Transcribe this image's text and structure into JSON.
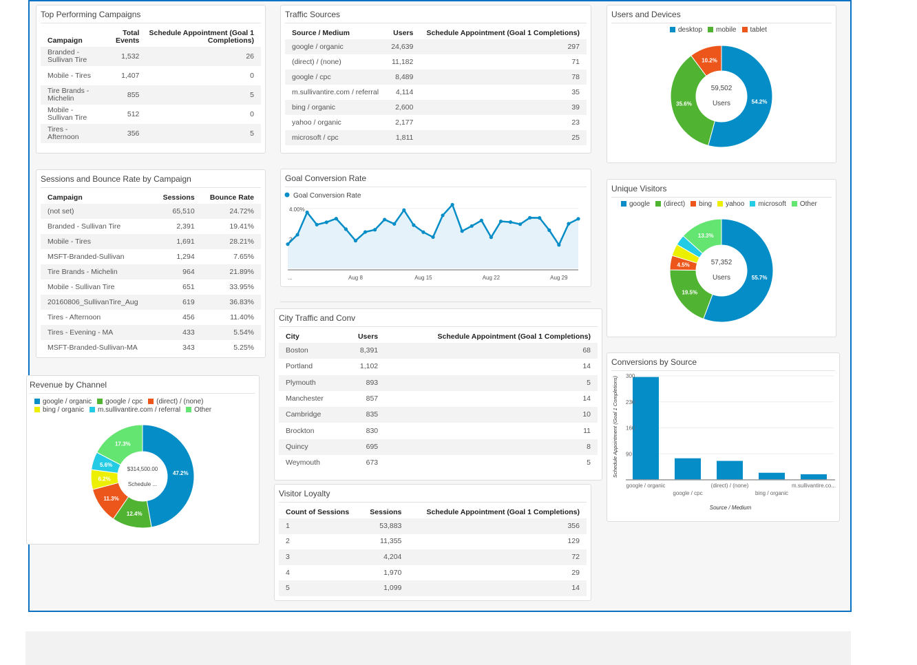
{
  "colors": {
    "frame": "#0a72c2",
    "blue": "#058dc7",
    "green": "#50b432",
    "orange": "#ed561b",
    "yellow": "#edef00",
    "cyan": "#24cbe5",
    "lightgreen": "#64e572"
  },
  "panels": {
    "top_campaigns": "Top Performing Campaigns",
    "traffic_sources": "Traffic Sources",
    "users_devices": "Users and Devices",
    "sessions_bounce": "Sessions and Bounce Rate by Campaign",
    "goal_conversion": "Goal Conversion Rate",
    "city_traffic": "City Traffic and Conv",
    "visitor_loyalty": "Visitor Loyalty",
    "unique_visitors": "Unique Visitors",
    "conversions_source": "Conversions by Source",
    "revenue_channel": "Revenue by Channel"
  },
  "top_campaigns": {
    "columns": [
      "Campaign",
      "Total Events",
      "Schedule Appointment (Goal 1 Completions)"
    ],
    "rows": [
      [
        "Branded - Sullivan Tire",
        "1,532",
        "26"
      ],
      [
        "Mobile - Tires",
        "1,407",
        "0"
      ],
      [
        "Tire Brands - Michelin",
        "855",
        "5"
      ],
      [
        "Mobile - Sullivan Tire",
        "512",
        "0"
      ],
      [
        "Tires - Afternoon",
        "356",
        "5"
      ]
    ]
  },
  "traffic_sources": {
    "columns": [
      "Source / Medium",
      "Users",
      "Schedule Appointment (Goal 1 Completions)"
    ],
    "rows": [
      [
        "google / organic",
        "24,639",
        "297"
      ],
      [
        "(direct) / (none)",
        "11,182",
        "71"
      ],
      [
        "google / cpc",
        "8,489",
        "78"
      ],
      [
        "m.sullivantire.com / referral",
        "4,114",
        "35"
      ],
      [
        "bing / organic",
        "2,600",
        "39"
      ],
      [
        "yahoo / organic",
        "2,177",
        "23"
      ],
      [
        "microsoft / cpc",
        "1,811",
        "25"
      ]
    ]
  },
  "sessions_bounce": {
    "columns": [
      "Campaign",
      "Sessions",
      "Bounce Rate"
    ],
    "rows": [
      [
        "(not set)",
        "65,510",
        "24.72%"
      ],
      [
        "Branded - Sullivan Tire",
        "2,391",
        "19.41%"
      ],
      [
        "Mobile - Tires",
        "1,691",
        "28.21%"
      ],
      [
        "MSFT-Branded-Sullivan",
        "1,294",
        "7.65%"
      ],
      [
        "Tire Brands - Michelin",
        "964",
        "21.89%"
      ],
      [
        "Mobile - Sullivan Tire",
        "651",
        "33.95%"
      ],
      [
        "20160806_SullivanTire_Aug",
        "619",
        "36.83%"
      ],
      [
        "Tires - Afternoon",
        "456",
        "11.40%"
      ],
      [
        "Tires - Evening - MA",
        "433",
        "5.54%"
      ],
      [
        "MSFT-Branded-Sullivan-MA",
        "343",
        "5.25%"
      ]
    ]
  },
  "city_traffic": {
    "columns": [
      "City",
      "Users",
      "Schedule Appointment (Goal 1 Completions)"
    ],
    "rows": [
      [
        "Boston",
        "8,391",
        "68"
      ],
      [
        "Portland",
        "1,102",
        "14"
      ],
      [
        "Plymouth",
        "893",
        "5"
      ],
      [
        "Manchester",
        "857",
        "14"
      ],
      [
        "Cambridge",
        "835",
        "10"
      ],
      [
        "Brockton",
        "830",
        "11"
      ],
      [
        "Quincy",
        "695",
        "8"
      ],
      [
        "Weymouth",
        "673",
        "5"
      ]
    ]
  },
  "visitor_loyalty": {
    "columns": [
      "Count of Sessions",
      "Sessions",
      "Schedule Appointment (Goal 1 Completions)"
    ],
    "rows": [
      [
        "1",
        "53,883",
        "356"
      ],
      [
        "2",
        "11,355",
        "129"
      ],
      [
        "3",
        "4,204",
        "72"
      ],
      [
        "4",
        "1,970",
        "29"
      ],
      [
        "5",
        "1,099",
        "14"
      ]
    ]
  },
  "chart_data": [
    {
      "type": "pie",
      "donut": true,
      "center_value": "59,502",
      "center_label": "Users",
      "legend_position": "top",
      "slices": [
        {
          "name": "desktop",
          "value": 54.2,
          "label": "54.2%",
          "color": "#058dc7"
        },
        {
          "name": "mobile",
          "value": 35.6,
          "label": "35.6%",
          "color": "#50b432"
        },
        {
          "name": "tablet",
          "value": 10.2,
          "label": "10.2%",
          "color": "#ed561b"
        }
      ]
    },
    {
      "type": "pie",
      "donut": true,
      "center_value": "57,352",
      "center_label": "Users",
      "legend_position": "top",
      "slices": [
        {
          "name": "google",
          "value": 55.7,
          "label": "55.7%",
          "color": "#058dc7"
        },
        {
          "name": "(direct)",
          "value": 19.5,
          "label": "19.5%",
          "color": "#50b432"
        },
        {
          "name": "bing",
          "value": 4.5,
          "label": "4.5%",
          "color": "#ed561b"
        },
        {
          "name": "yahoo",
          "value": 3.7,
          "label": "",
          "color": "#edef00"
        },
        {
          "name": "microsoft",
          "value": 3.3,
          "label": "",
          "color": "#24cbe5"
        },
        {
          "name": "Other",
          "value": 13.3,
          "label": "13.3%",
          "color": "#64e572"
        }
      ]
    },
    {
      "type": "pie",
      "donut": true,
      "center_value": "$314,500.00",
      "center_label": "Schedule ...",
      "legend_position": "top",
      "slices": [
        {
          "name": "google / organic",
          "value": 47.2,
          "label": "47.2%",
          "color": "#058dc7"
        },
        {
          "name": "google / cpc",
          "value": 12.4,
          "label": "12.4%",
          "color": "#50b432"
        },
        {
          "name": "(direct) / (none)",
          "value": 11.3,
          "label": "11.3%",
          "color": "#ed561b"
        },
        {
          "name": "bing / organic",
          "value": 6.2,
          "label": "6.2%",
          "color": "#edef00"
        },
        {
          "name": "m.sullivantire.com / referral",
          "value": 5.6,
          "label": "5.6%",
          "color": "#24cbe5"
        },
        {
          "name": "Other",
          "value": 17.3,
          "label": "17.3%",
          "color": "#64e572"
        }
      ]
    },
    {
      "type": "area",
      "series": [
        {
          "name": "Goal Conversion Rate",
          "color": "#058dc7",
          "values": [
            1.62,
            2.25,
            3.74,
            2.92,
            3.08,
            3.32,
            2.62,
            1.85,
            2.43,
            2.58,
            3.26,
            2.97,
            3.89,
            2.89,
            2.42,
            2.09,
            3.54,
            4.25,
            2.49,
            2.83,
            3.2,
            2.08,
            3.14,
            3.09,
            2.95,
            3.38,
            3.37,
            2.55,
            1.57,
            2.98,
            3.31
          ]
        }
      ],
      "x_tick_labels": [
        {
          "index": 0,
          "label": "..."
        },
        {
          "index": 7,
          "label": "Aug 8"
        },
        {
          "index": 14,
          "label": "Aug 15"
        },
        {
          "index": 21,
          "label": "Aug 22"
        },
        {
          "index": 28,
          "label": "Aug 29"
        }
      ],
      "y_ticks": [
        {
          "value": 4,
          "label": "4.00%"
        },
        {
          "value": 2,
          "label": "2.00%"
        }
      ],
      "ylim": [
        0,
        4.5
      ],
      "grid": true,
      "legend_position": "top-left"
    },
    {
      "type": "bar",
      "categories": [
        "google / organic",
        "google / cpc",
        "(direct) / (none)",
        "bing / organic",
        "m.sullivantire.co..."
      ],
      "values": [
        297,
        78,
        71,
        39,
        35
      ],
      "color": "#058dc7",
      "xlabel": "Source / Medium",
      "ylabel": "Schedule Appointment (Goal 1 Completions)",
      "y_ticks": [
        300,
        230,
        160,
        90
      ],
      "ylim": [
        20,
        300
      ],
      "grid": true
    }
  ]
}
